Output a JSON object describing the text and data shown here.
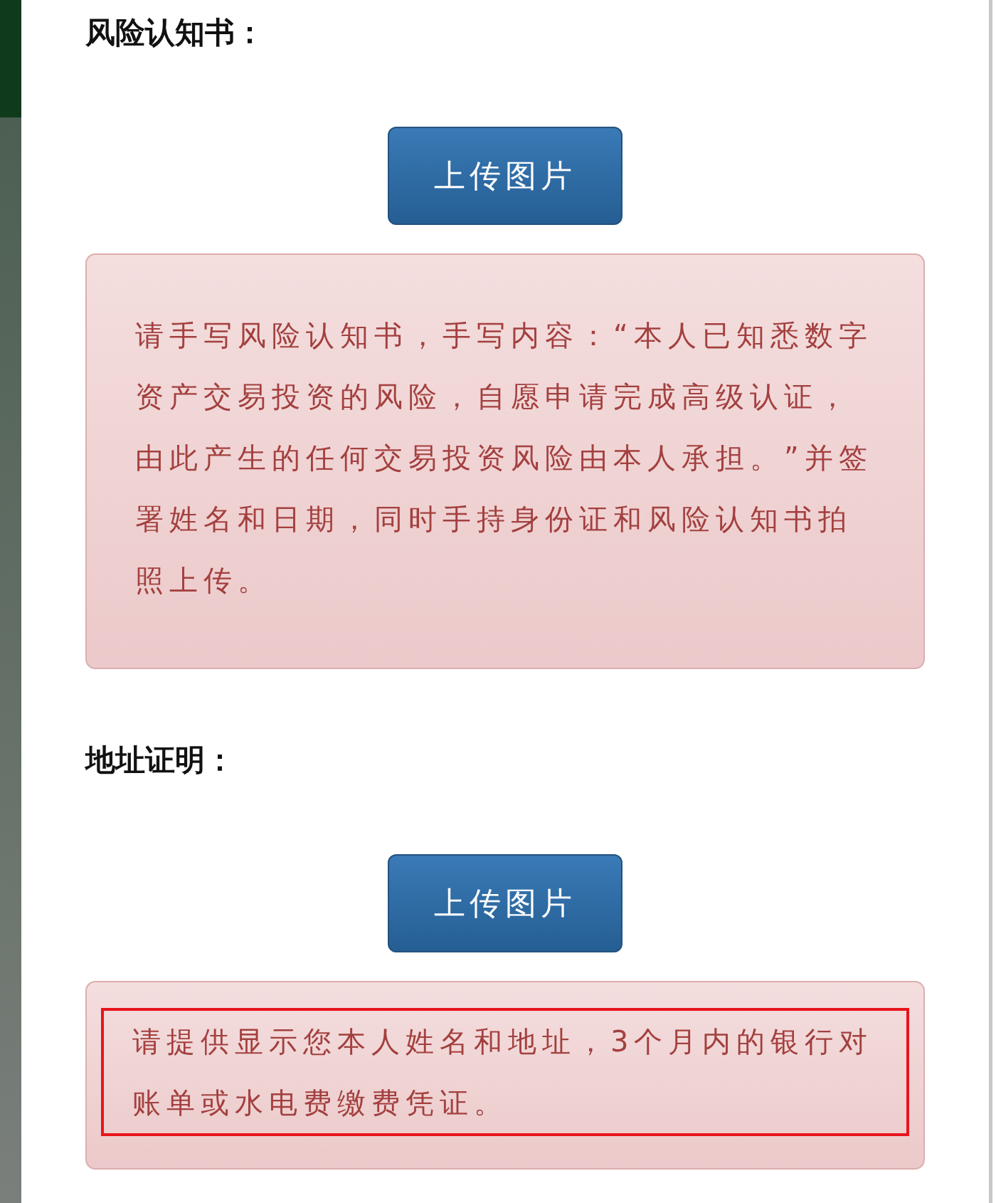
{
  "sections": [
    {
      "title": "风险认知书：",
      "upload_button": "上传图片",
      "notice": {
        "text": "请手写风险认知书，手写内容：“本人已知悉数字资产交易投资的风险，自愿申请完成高级认证，由此产生的任何交易投资风险由本人承担。”并签署姓名和日期，同时手持身份证和风险认知书拍照上传。",
        "highlighted": false
      }
    },
    {
      "title": "地址证明：",
      "upload_button": "上传图片",
      "notice": {
        "text": "请提供显示您本人姓名和地址，3个月内的银行对账单或水电费缴费凭证。",
        "highlighted": true
      }
    }
  ]
}
